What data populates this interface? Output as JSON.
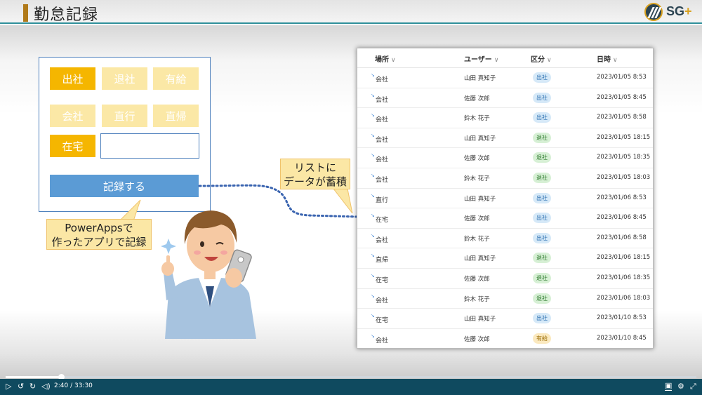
{
  "header": {
    "title": "勤怠記録",
    "logo_text": "SG",
    "logo_plus": "+"
  },
  "form": {
    "chips": [
      {
        "label": "出社",
        "active": true
      },
      {
        "label": "退社",
        "active": false
      },
      {
        "label": "有給",
        "active": false
      },
      {
        "label": "会社",
        "active": false
      },
      {
        "label": "直行",
        "active": false
      },
      {
        "label": "直帰",
        "active": false
      },
      {
        "label": "在宅",
        "active": true
      }
    ],
    "submit_label": "記録する"
  },
  "callouts": {
    "app_line1": "PowerAppsで",
    "app_line2": "作ったアプリで記録",
    "list_line1": "リストに",
    "list_line2": "データが蓄積"
  },
  "list": {
    "columns": [
      "場所",
      "ユーザー",
      "区分",
      "日時"
    ],
    "rows": [
      {
        "place": "会社",
        "user": "山田 真知子",
        "type": "出社",
        "kind": "in",
        "date": "2023/01/05 8:53"
      },
      {
        "place": "会社",
        "user": "佐藤 次郎",
        "type": "出社",
        "kind": "in",
        "date": "2023/01/05 8:45"
      },
      {
        "place": "会社",
        "user": "鈴木 花子",
        "type": "出社",
        "kind": "in",
        "date": "2023/01/05 8:58"
      },
      {
        "place": "会社",
        "user": "山田 真知子",
        "type": "退社",
        "kind": "out",
        "date": "2023/01/05 18:15"
      },
      {
        "place": "会社",
        "user": "佐藤 次郎",
        "type": "退社",
        "kind": "out",
        "date": "2023/01/05 18:35"
      },
      {
        "place": "会社",
        "user": "鈴木 花子",
        "type": "退社",
        "kind": "out",
        "date": "2023/01/05 18:03"
      },
      {
        "place": "直行",
        "user": "山田 真知子",
        "type": "出社",
        "kind": "in",
        "date": "2023/01/06 8:53"
      },
      {
        "place": "在宅",
        "user": "佐藤 次郎",
        "type": "出社",
        "kind": "in",
        "date": "2023/01/06 8:45"
      },
      {
        "place": "会社",
        "user": "鈴木 花子",
        "type": "出社",
        "kind": "in",
        "date": "2023/01/06 8:58"
      },
      {
        "place": "直帰",
        "user": "山田 真知子",
        "type": "退社",
        "kind": "out",
        "date": "2023/01/06 18:15"
      },
      {
        "place": "在宅",
        "user": "佐藤 次郎",
        "type": "退社",
        "kind": "out",
        "date": "2023/01/06 18:35"
      },
      {
        "place": "会社",
        "user": "鈴木 花子",
        "type": "退社",
        "kind": "out",
        "date": "2023/01/06 18:03"
      },
      {
        "place": "在宅",
        "user": "山田 真知子",
        "type": "出社",
        "kind": "in",
        "date": "2023/01/10 8:53"
      },
      {
        "place": "会社",
        "user": "佐藤 次郎",
        "type": "有給",
        "kind": "paid",
        "date": "2023/01/10 8:45"
      }
    ]
  },
  "player": {
    "time": "2:40 / 33:30",
    "progress": 0.08,
    "icons": [
      "play-icon",
      "rewind-10-icon",
      "forward-10-icon",
      "volume-icon",
      "captions-icon",
      "settings-icon",
      "fullscreen-icon"
    ]
  },
  "colors": {
    "accent_yellow": "#f5b600",
    "light_yellow": "#fbe8a6",
    "button_blue": "#5b9bd5",
    "player_bar": "#0f4a5f",
    "header_line": "#2f8f9a"
  }
}
